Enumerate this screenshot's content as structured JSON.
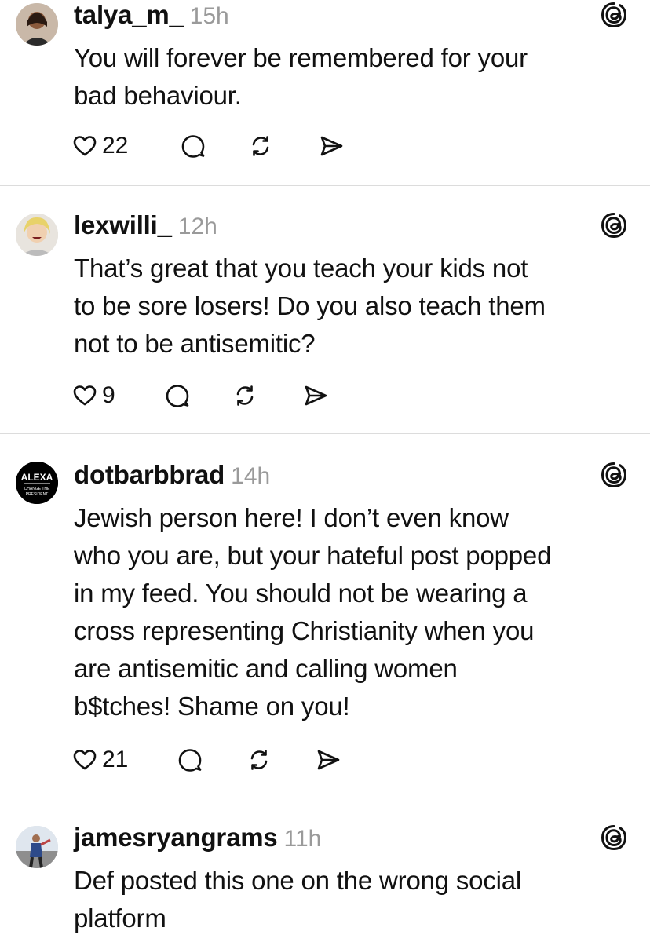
{
  "posts": [
    {
      "username": "talya_m_",
      "time": "15h",
      "avatar": "photo-avatar",
      "lines": [
        "You will forever be remembered for your",
        "bad behaviour."
      ],
      "likes": "22"
    },
    {
      "username": "lexwilli_",
      "time": "12h",
      "avatar": "photo-avatar",
      "lines": [
        "That’s great that you teach your kids not",
        "to be sore losers! Do you also teach them",
        "not to be antisemitic?"
      ],
      "likes": "9"
    },
    {
      "username": "dotbarbbrad",
      "time": "14h",
      "avatar": "text-avatar",
      "avatar_text_top": "ALEXA",
      "avatar_text_bottom": "CHANGE THE PRESIDENT",
      "lines": [
        "Jewish person here! I don’t even know",
        "who you are, but your hateful post popped",
        "in my feed. You should not be wearing a",
        "cross representing Christianity when you",
        "are antisemitic and calling women",
        "b$tches! Shame on you!"
      ],
      "likes": "21"
    },
    {
      "username": "jamesryangrams",
      "time": "11h",
      "avatar": "photo-avatar",
      "lines": [
        "Def posted this one on the wrong social",
        "platform"
      ],
      "likes": ""
    }
  ],
  "icons": {
    "like": "heart-icon",
    "reply": "comment-bubble-icon",
    "repost": "repost-icon",
    "share": "send-icon",
    "brand": "threads-logo-icon"
  },
  "colors": {
    "text": "#111111",
    "muted": "#9a9a9a",
    "divider": "#dcdcdc"
  }
}
